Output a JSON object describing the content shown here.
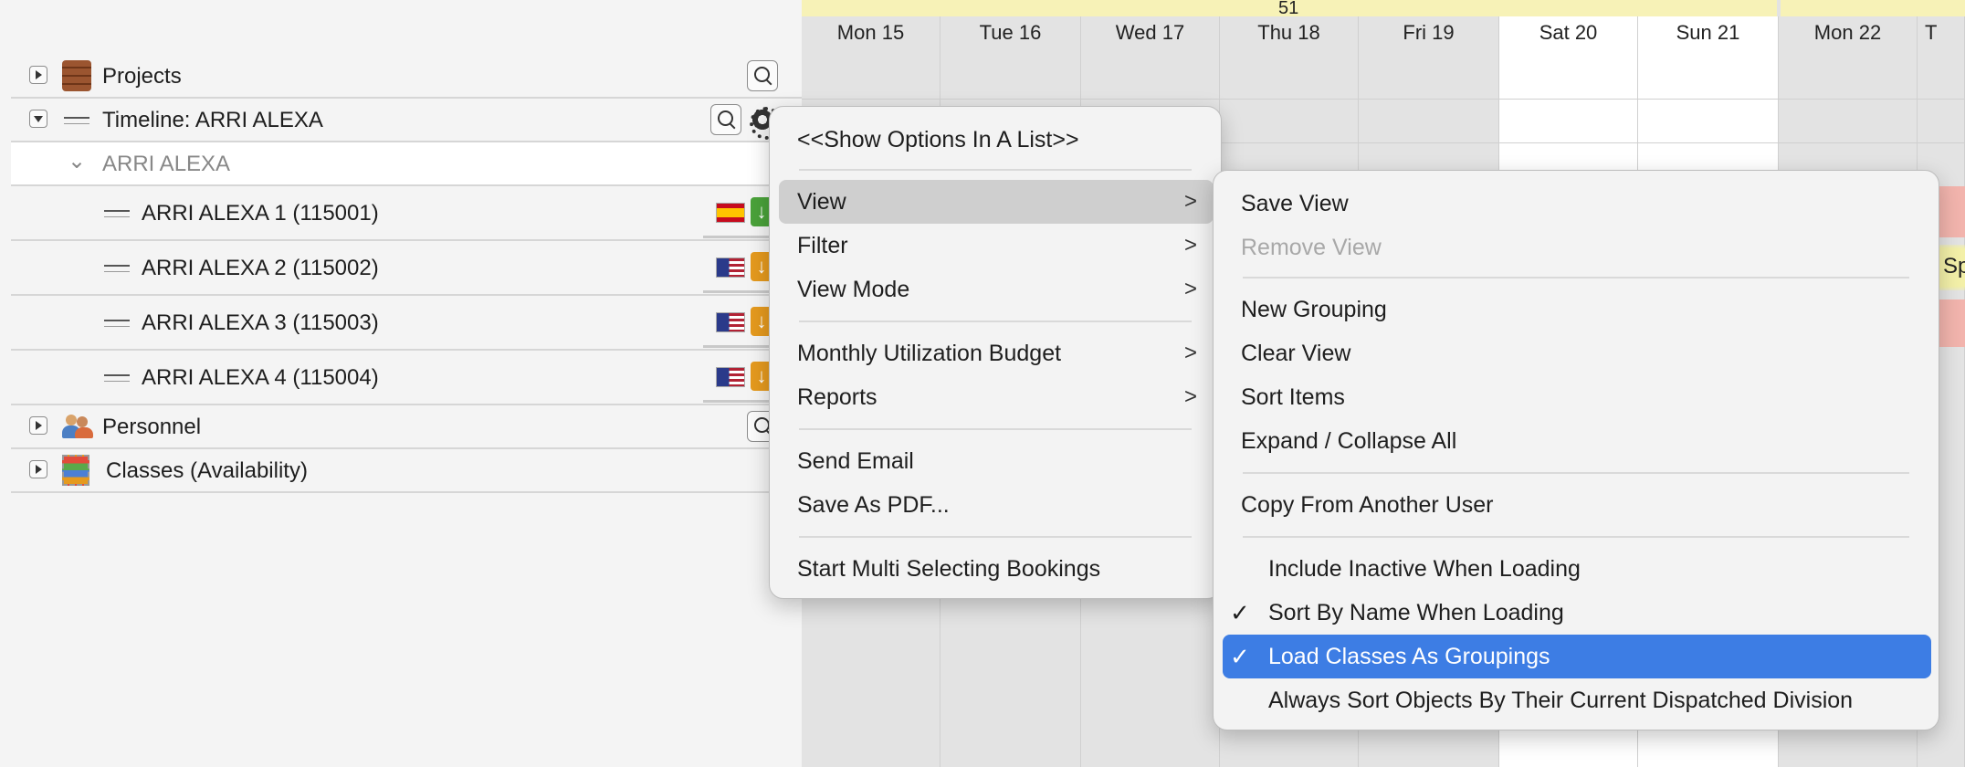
{
  "tree": {
    "projects_label": "Projects",
    "timeline_label": "Timeline: ARRI ALEXA",
    "group_label": "ARRI ALEXA",
    "items": [
      {
        "label": "ARRI ALEXA 1 (115001)",
        "flag": "es-flag-icon",
        "status": "green"
      },
      {
        "label": "ARRI ALEXA 2 (115002)",
        "flag": "us-flag-icon",
        "status": "orange"
      },
      {
        "label": "ARRI ALEXA 3 (115003)",
        "flag": "us-flag-icon",
        "status": "orange"
      },
      {
        "label": "ARRI ALEXA 4 (115004)",
        "flag": "us-flag-icon",
        "status": "orange"
      }
    ],
    "personnel_label": "Personnel",
    "classes_label": "Classes (Availability)"
  },
  "calendar": {
    "week_number": "51",
    "days": [
      "Mon 15",
      "Tue 16",
      "Wed 17",
      "Thu 18",
      "Fri 19",
      "Sat 20",
      "Sun 21",
      "Mon 22",
      "T"
    ],
    "booking_fragment": "Sp"
  },
  "context_menu": {
    "show_options": "<<Show Options In A List>>",
    "view": "View",
    "filter": "Filter",
    "view_mode": "View Mode",
    "monthly_budget": "Monthly Utilization Budget",
    "reports": "Reports",
    "send_email": "Send Email",
    "save_pdf": "Save As PDF...",
    "multi_select": "Start Multi Selecting Bookings",
    "submenu_arrow": ">"
  },
  "view_submenu": {
    "save_view": "Save View",
    "remove_view": "Remove View",
    "new_grouping": "New Grouping",
    "clear_view": "Clear View",
    "sort_items": "Sort Items",
    "expand_collapse": "Expand / Collapse All",
    "copy_from_user": "Copy From Another User",
    "include_inactive": "Include Inactive When Loading",
    "sort_by_name": "Sort By Name When Loading",
    "load_classes": "Load Classes As Groupings",
    "always_sort": "Always Sort Objects By Their Current Dispatched Division",
    "checkmark": "✓"
  },
  "colors": {
    "menu_selection": "#3d7de4",
    "week_strip": "#f7f2b7",
    "booking_red": "#f2b4ad",
    "booking_yellow": "#f3f0a8"
  }
}
